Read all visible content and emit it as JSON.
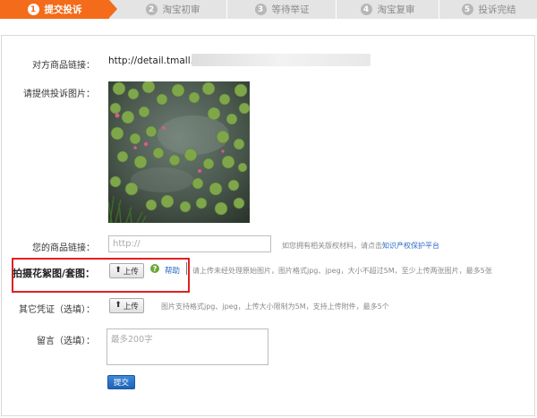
{
  "steps": [
    {
      "num": "1",
      "label": "提交投诉",
      "active": true
    },
    {
      "num": "2",
      "label": "淘宝初审",
      "active": false
    },
    {
      "num": "3",
      "label": "等待举证",
      "active": false
    },
    {
      "num": "4",
      "label": "淘宝复审",
      "active": false
    },
    {
      "num": "5",
      "label": "投诉完结",
      "active": false
    }
  ],
  "form": {
    "other_link_label": "对方商品链接：",
    "other_link_value": "http://detail.tmall.con",
    "image_label": "请提供投诉图片：",
    "your_link_label": "您的商品链接：",
    "your_link_placeholder": "http://",
    "your_link_hint": "如您拥有相关版权材料，请点击",
    "your_link_hint_link": "知识产权保护平台",
    "photo_label": "拍摄花絮图/套图：",
    "upload_label": "上传",
    "help_label": "帮助",
    "photo_hint": "请上传未经处理原始图片，图片格式jpg、jpeg，大小不超过5M，至少上传两张图片，最多5张",
    "other_proof_label": "其它凭证（选填）：",
    "other_proof_hint": "图片支持格式jpg、jpeg，上传大小限制为5M，支持上传附件，最多5个",
    "message_label": "留言（选填）：",
    "message_placeholder": "最多200字",
    "submit_label": "提交"
  },
  "colors": {
    "step_active": "#f36b1b",
    "step_inactive": "#e4e4e4",
    "highlight_box": "#e02020",
    "link": "#2a6bc4",
    "submit": "#1f63b6"
  }
}
